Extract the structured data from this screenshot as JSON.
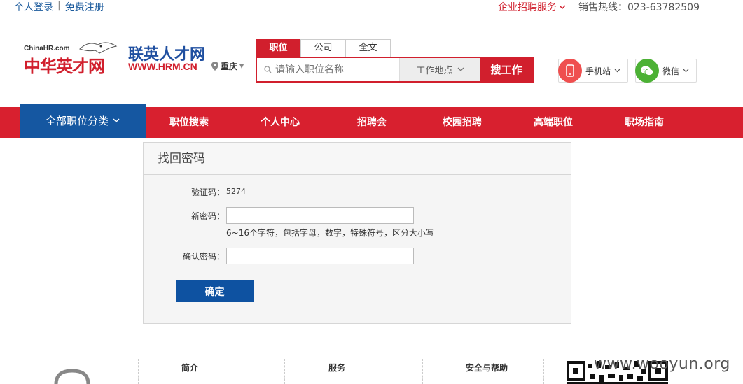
{
  "topbar": {
    "login": "个人登录",
    "register": "免费注册",
    "corp_service": "企业招聘服务",
    "hotline": "销售热线：023-63782509"
  },
  "logo": {
    "chinahr_small": "ChinaHR.com",
    "chinahr_name": "中华英才网",
    "lianying_name": "联英人才网",
    "lianying_url": "WWW.HRM.CN"
  },
  "city": "重庆",
  "search": {
    "tabs": [
      "职位",
      "公司",
      "全文"
    ],
    "placeholder": "请输入职位名称",
    "location": "工作地点",
    "button": "搜工作"
  },
  "apps": {
    "mobile": "手机站",
    "wechat": "微信"
  },
  "nav": {
    "all": "全部职位分类",
    "items": [
      "职位搜索",
      "个人中心",
      "招聘会",
      "校园招聘",
      "高端职位",
      "职场指南"
    ]
  },
  "form": {
    "title": "找回密码",
    "captcha_label": "验证码：",
    "captcha_value": "5274",
    "new_pw_label": "新密码：",
    "new_pw_hint": "6~16个字符，包括字母，数字，特殊符号，区分大小写",
    "confirm_pw_label": "确认密码：",
    "submit": "确定"
  },
  "footer": {
    "cols": [
      "简介",
      "服务",
      "安全与帮助"
    ],
    "watermark": "www.wooyun.org"
  },
  "colors": {
    "brand_red": "#d8202f",
    "brand_blue": "#1557a1"
  }
}
